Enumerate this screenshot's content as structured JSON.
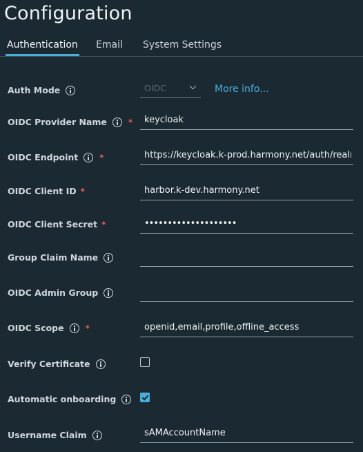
{
  "page": {
    "title": "Configuration"
  },
  "tabs": [
    {
      "label": "Authentication",
      "active": true
    },
    {
      "label": "Email",
      "active": false
    },
    {
      "label": "System Settings",
      "active": false
    }
  ],
  "form": {
    "auth_mode": {
      "label": "Auth Mode",
      "value": "OIDC",
      "more_info": "More info..."
    },
    "oidc_provider_name": {
      "label": "OIDC Provider Name",
      "required": "*",
      "value": "keycloak"
    },
    "oidc_endpoint": {
      "label": "OIDC Endpoint",
      "required": "*",
      "value": "https://keycloak.k-prod.harmony.net/auth/realms"
    },
    "oidc_client_id": {
      "label": "OIDC Client ID",
      "required": "*",
      "value": "harbor.k-dev.harmony.net"
    },
    "oidc_client_secret": {
      "label": "OIDC Client Secret",
      "required": "*",
      "value": "xxxxxxxxxxxxxxxxxxxx"
    },
    "group_claim_name": {
      "label": "Group Claim Name",
      "value": ""
    },
    "oidc_admin_group": {
      "label": "OIDC Admin Group",
      "value": ""
    },
    "oidc_scope": {
      "label": "OIDC Scope",
      "required": "*",
      "value": "openid,email,profile,offline_access"
    },
    "verify_certificate": {
      "label": "Verify Certificate",
      "checked": false
    },
    "automatic_onboarding": {
      "label": "Automatic onboarding",
      "checked": true
    },
    "username_claim": {
      "label": "Username Claim",
      "value": "sAMAccountName"
    }
  },
  "colors": {
    "background": "#1b2a32",
    "accent": "#49afd9",
    "required": "#e35a5a"
  }
}
